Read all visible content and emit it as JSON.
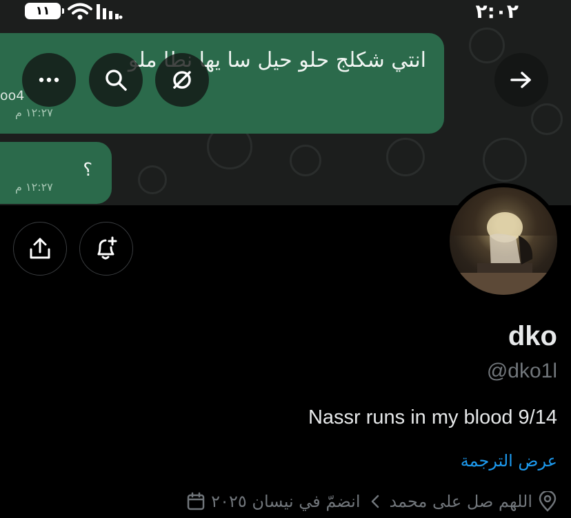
{
  "status_bar": {
    "battery": "١١",
    "time": "٢:٠٢"
  },
  "banner": {
    "messages": [
      {
        "text": "انتي شكلج حلو حيل سا    يها  نطا  ملو",
        "time": "١٢:٢٧ م",
        "sender": "oo4"
      },
      {
        "text": "؟",
        "time": "١٢:٢٧ م"
      }
    ]
  },
  "overlay_buttons": {
    "icons": [
      "more-icon",
      "search-icon",
      "grok-icon",
      "forward-arrow-icon"
    ]
  },
  "actions": {
    "icons": [
      "share-icon",
      "notification-add-icon"
    ]
  },
  "profile": {
    "name": "dko",
    "handle": "@dko1l",
    "bio": "Nassr runs in my blood 9/14",
    "translate_label": "عرض الترجمة",
    "location": "اللهم صل على محمد",
    "joined": "انضمّ في نيسان ٢٠٢٥"
  },
  "colors": {
    "accent": "#1d9bf0",
    "bubble": "#2b6a4b",
    "muted": "#71767b"
  }
}
